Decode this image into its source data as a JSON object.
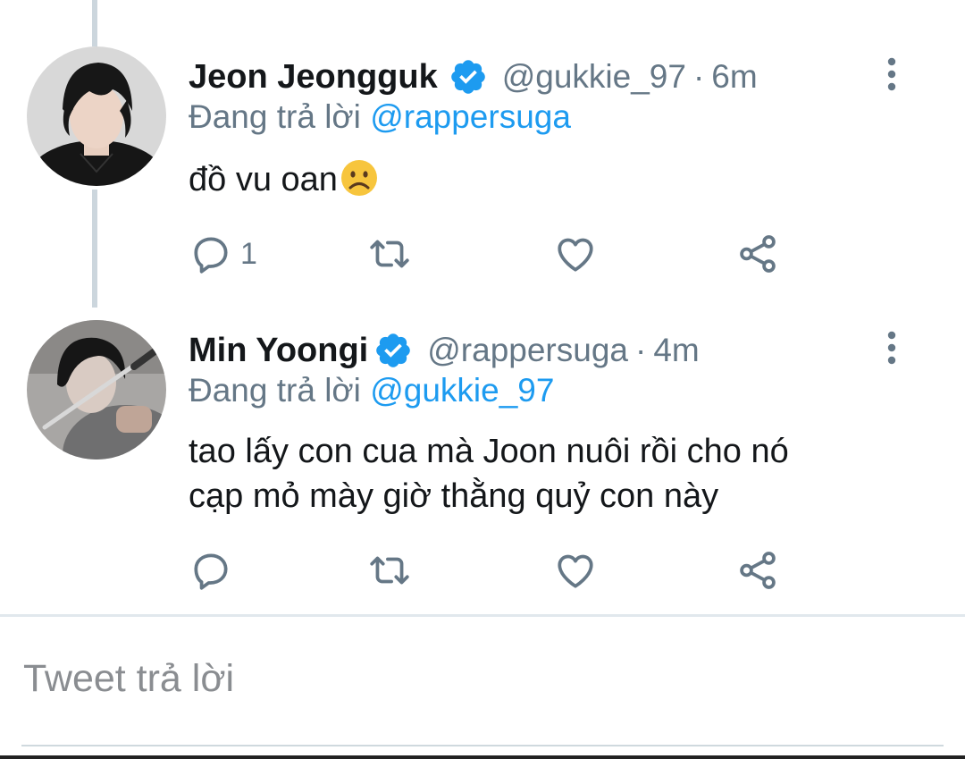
{
  "colors": {
    "accent": "#1d9bf0",
    "secondary_text": "#657786",
    "primary_text": "#14171a",
    "thread_line": "#ccd6dd"
  },
  "tweets": [
    {
      "display_name": "Jeon Jeongguk",
      "verified": true,
      "handle": "@gukkie_97",
      "separator": "·",
      "time": "6m",
      "replying_label": "Đang trả lời",
      "replying_to": "@rappersuga",
      "text": "đồ vu oan",
      "emoji": "frowning-face",
      "reply_count": "1",
      "icons": [
        "reply-icon",
        "retweet-icon",
        "like-icon",
        "share-icon"
      ]
    },
    {
      "display_name": "Min Yoongi",
      "verified": true,
      "handle": "@rappersuga",
      "separator": "·",
      "time": "4m",
      "replying_label": "Đang trả lời",
      "replying_to": "@gukkie_97",
      "text_line1": "tao lấy con cua mà Joon nuôi rồi cho nó",
      "text_line2": "cạp mỏ mày giờ thằng quỷ con này",
      "icons": [
        "reply-icon",
        "retweet-icon",
        "like-icon",
        "share-icon"
      ]
    }
  ],
  "compose": {
    "placeholder": "Tweet trả lời"
  }
}
